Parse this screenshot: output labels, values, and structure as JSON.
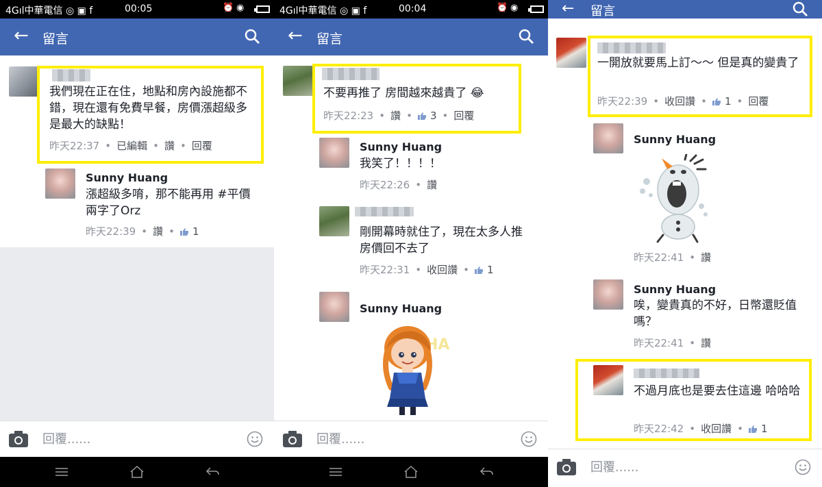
{
  "status_bar": {
    "signal": "4G",
    "carrier": "中華電信",
    "clock_left": "00:05",
    "clock_mid": "00:04"
  },
  "header": {
    "title": "留言",
    "back_icon": "arrow-left-icon",
    "search_icon": "search-icon"
  },
  "reply_bar": {
    "placeholder": "回覆......",
    "camera_icon": "camera-icon",
    "emoji_icon": "smiley-icon"
  },
  "nav_bar": [
    "menu-icon",
    "home-icon",
    "back-icon"
  ],
  "panels": [
    {
      "comments": [
        {
          "author": "",
          "text": "我們現在正在住，地點和房內設施都不錯，現在還有免費早餐，房價漲超級多是最大的缺點！",
          "time": "昨天22:37",
          "actions": [
            "已編輯",
            "讚",
            "回覆"
          ],
          "highlighted": true
        },
        {
          "author": "Sunny Huang",
          "text": "漲超級多唷，那不能再用 #平價 兩字了Orz",
          "time": "昨天22:39",
          "actions": [
            "讚"
          ],
          "likes": "1"
        }
      ]
    },
    {
      "comments": [
        {
          "author": "",
          "text": "不要再推了 房間越來越貴了 😂",
          "time": "昨天22:23",
          "actions": [
            "讚"
          ],
          "likes": "3",
          "reply_label": "回覆",
          "highlighted": true
        },
        {
          "author": "Sunny Huang",
          "text": "我笑了！！！！",
          "time": "昨天22:26",
          "actions": [
            "讚"
          ]
        },
        {
          "author": "",
          "text": "剛開幕時就住了，現在太多人推房價回不去了",
          "time": "昨天22:31",
          "actions": [
            "收回讚"
          ],
          "likes": "1"
        },
        {
          "author": "Sunny Huang",
          "sticker": "anna-sticker",
          "sticker_text": "HA"
        }
      ]
    },
    {
      "comments": [
        {
          "author": "",
          "text": "一開放就要馬上訂～～ 但是真的變貴了",
          "time": "昨天22:39",
          "actions": [
            "收回讚"
          ],
          "likes": "1",
          "reply_label": "回覆",
          "highlighted": true
        },
        {
          "author": "Sunny Huang",
          "sticker": "olaf-sticker",
          "time": "昨天22:41",
          "actions": [
            "讚"
          ]
        },
        {
          "author": "Sunny Huang",
          "text": "唉，變貴真的不好，日幣還貶值嗎？",
          "time": "昨天22:41",
          "actions": [
            "讚"
          ]
        },
        {
          "author": "",
          "text": "不過月底也是要去住這邊 哈哈哈",
          "time": "昨天22:42",
          "actions": [
            "收回讚"
          ],
          "likes": "1",
          "highlighted": true
        }
      ]
    }
  ],
  "colors": {
    "header_blue": "#4267b2",
    "highlight_yellow": "#ffee00",
    "meta_grey": "#90949c",
    "like_blue": "#7f9ccf"
  }
}
